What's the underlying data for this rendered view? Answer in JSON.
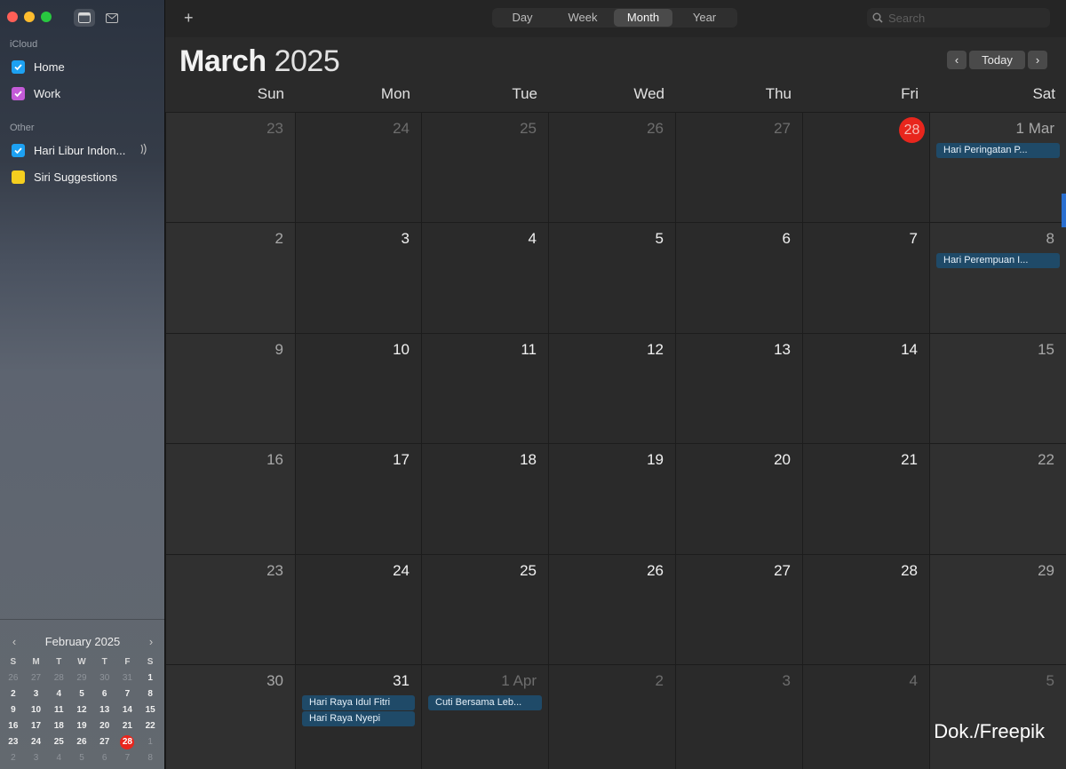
{
  "sidebar": {
    "icloud_label": "iCloud",
    "calendars": [
      {
        "label": "Home",
        "color": "#1da1f2"
      },
      {
        "label": "Work",
        "color": "#c45bd8"
      }
    ],
    "other_label": "Other",
    "other_calendars": [
      {
        "label": "Hari Libur Indon...",
        "color": "#1da1f2"
      },
      {
        "label": "Siri Suggestions",
        "color": "#f5cf1f"
      }
    ]
  },
  "mini_calendar": {
    "title": "February 2025",
    "weekdays": [
      "S",
      "M",
      "T",
      "W",
      "T",
      "F",
      "S"
    ],
    "rows": [
      [
        "26",
        "27",
        "28",
        "29",
        "30",
        "31",
        "1"
      ],
      [
        "2",
        "3",
        "4",
        "5",
        "6",
        "7",
        "8"
      ],
      [
        "9",
        "10",
        "11",
        "12",
        "13",
        "14",
        "15"
      ],
      [
        "16",
        "17",
        "18",
        "19",
        "20",
        "21",
        "22"
      ],
      [
        "23",
        "24",
        "25",
        "26",
        "27",
        "28",
        "1"
      ],
      [
        "2",
        "3",
        "4",
        "5",
        "6",
        "7",
        "8"
      ]
    ],
    "today": "28"
  },
  "toolbar": {
    "add_label": "+",
    "views": [
      "Day",
      "Week",
      "Month",
      "Year"
    ],
    "active_view": "Month",
    "search_placeholder": "Search"
  },
  "header": {
    "month": "March",
    "year": "2025",
    "prev": "‹",
    "today_label": "Today",
    "next": "›"
  },
  "weekdays": [
    "Sun",
    "Mon",
    "Tue",
    "Wed",
    "Thu",
    "Fri",
    "Sat"
  ],
  "month_grid": [
    [
      "23",
      "24",
      "25",
      "26",
      "27",
      "28",
      "1 Mar"
    ],
    [
      "2",
      "3",
      "4",
      "5",
      "6",
      "7",
      "8"
    ],
    [
      "9",
      "10",
      "11",
      "12",
      "13",
      "14",
      "15"
    ],
    [
      "16",
      "17",
      "18",
      "19",
      "20",
      "21",
      "22"
    ],
    [
      "23",
      "24",
      "25",
      "26",
      "27",
      "28",
      "29"
    ],
    [
      "30",
      "31",
      "1 Apr",
      "2",
      "3",
      "4",
      "5"
    ]
  ],
  "events": {
    "mar1": [
      "Hari Peringatan P..."
    ],
    "mar8": [
      "Hari Perempuan I..."
    ],
    "mar31": [
      "Hari Raya Idul Fitri",
      "Hari Raya Nyepi"
    ],
    "apr1": [
      "Cuti Bersama Leb..."
    ]
  },
  "colors": {
    "accent_red": "#e8261d",
    "event_blue": "#1f4a68"
  },
  "credit": "Dok./Freepik"
}
